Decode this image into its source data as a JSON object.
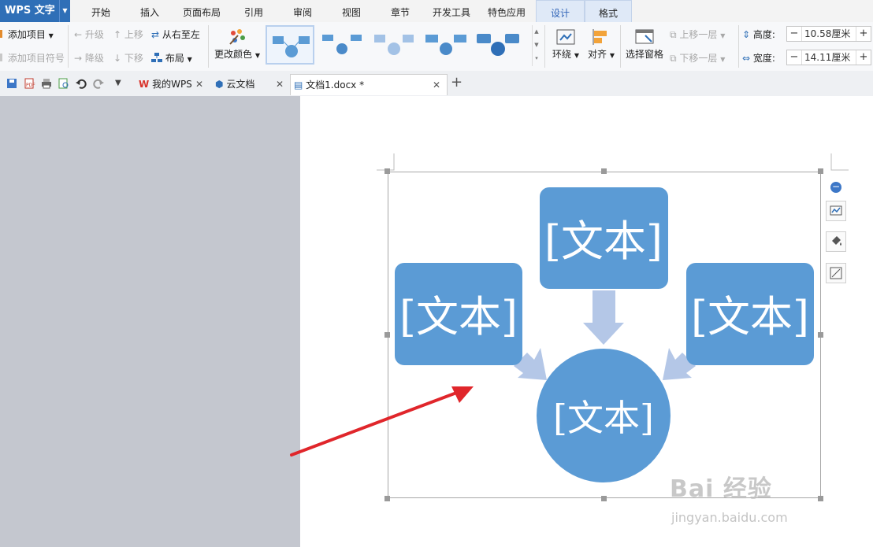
{
  "app": {
    "name": "WPS 文字"
  },
  "menu_tabs": [
    "开始",
    "插入",
    "页面布局",
    "引用",
    "审阅",
    "视图",
    "章节",
    "开发工具",
    "特色应用",
    "设计",
    "格式"
  ],
  "ribbon": {
    "add_item": "添加项目",
    "add_item_bullet": "添加项目符号",
    "promote": "升级",
    "demote": "降级",
    "move_up": "上移",
    "move_down": "下移",
    "right_to_left": "从右至左",
    "layout": "布局",
    "change_color": "更改颜色",
    "wrap": "环绕",
    "align": "对齐",
    "selection_pane": "选择窗格",
    "bring_forward": "上移一层",
    "send_backward": "下移一层",
    "height_label": "高度:",
    "height_value": "10.58厘米",
    "width_label": "宽度:",
    "width_value": "14.11厘米"
  },
  "doc_tabs": [
    {
      "label": "我的WPS",
      "icon": "wps-logo-icon"
    },
    {
      "label": "云文档",
      "icon": "cloud-cube-icon"
    },
    {
      "label": "文档1.docx *",
      "icon": "document-icon",
      "active": true
    }
  ],
  "smartart": {
    "top_text": "[文本]",
    "left_text": "[文本]",
    "right_text": "[文本]",
    "center_text": "[文本]",
    "box_color": "#5b9bd5",
    "arrow_color": "#b4c7e7"
  },
  "annotation": {
    "arrow_color": "#e0262b"
  },
  "watermark": {
    "brand": "Bai 经验",
    "url": "jingyan.baidu.com"
  }
}
